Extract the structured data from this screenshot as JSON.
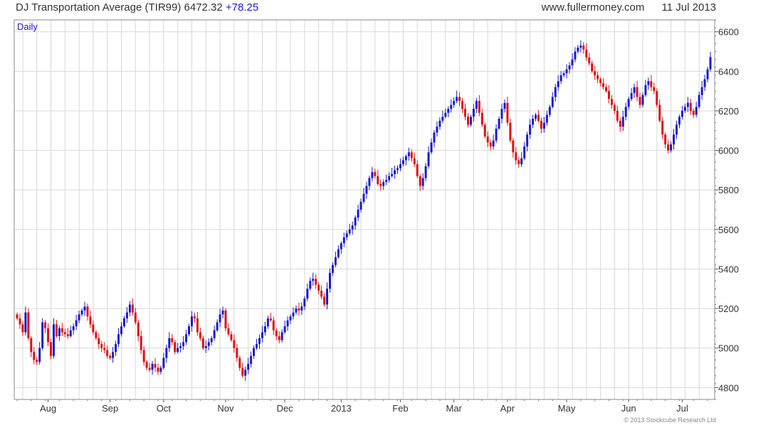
{
  "header": {
    "title": "DJ Transportation Average (TIR99)",
    "last": "6472.32",
    "change": "+78.25",
    "site": "www.fullermoney.com",
    "date": "11 Jul 2013"
  },
  "footer": {
    "copyright": "© 2013 Stockcube Research Ltd"
  },
  "colors": {
    "up": "#1a1acc",
    "down": "#dd1111",
    "grid": "#d8d8d8",
    "frame": "#888888"
  },
  "chart_data": {
    "type": "ohlc-bar",
    "period_label": "Daily",
    "ylim": [
      4740,
      6660
    ],
    "y_ticks": [
      4800,
      5000,
      5200,
      5400,
      5600,
      5800,
      6000,
      6200,
      6400,
      6600
    ],
    "y_axis_side": "right",
    "grid": true,
    "x_labels": [
      {
        "label": "Aug",
        "index": 11
      },
      {
        "label": "Sep",
        "index": 33
      },
      {
        "label": "Oct",
        "index": 52
      },
      {
        "label": "Nov",
        "index": 74
      },
      {
        "label": "Dec",
        "index": 95
      },
      {
        "label": "2013",
        "index": 115
      },
      {
        "label": "Feb",
        "index": 136
      },
      {
        "label": "Mar",
        "index": 155
      },
      {
        "label": "Apr",
        "index": 174
      },
      {
        "label": "May",
        "index": 195
      },
      {
        "label": "Jun",
        "index": 217
      },
      {
        "label": "Jul",
        "index": 236
      }
    ],
    "closes": [
      5150,
      5120,
      5080,
      5180,
      5050,
      4980,
      4940,
      4930,
      5000,
      5130,
      5100,
      5030,
      4960,
      5120,
      5060,
      5100,
      5080,
      5070,
      5060,
      5090,
      5110,
      5140,
      5170,
      5190,
      5210,
      5160,
      5120,
      5080,
      5050,
      5020,
      5000,
      4990,
      4960,
      4950,
      4980,
      5020,
      5070,
      5110,
      5150,
      5180,
      5220,
      5180,
      5130,
      5060,
      4990,
      4930,
      4900,
      4890,
      4920,
      4900,
      4880,
      4900,
      4950,
      5000,
      5050,
      5030,
      4980,
      5000,
      5010,
      5030,
      5070,
      5110,
      5160,
      5150,
      5080,
      5050,
      5000,
      5010,
      5030,
      5050,
      5090,
      5130,
      5170,
      5190,
      5100,
      5070,
      5040,
      5000,
      4950,
      4900,
      4860,
      4890,
      4920,
      4960,
      5000,
      5020,
      5050,
      5080,
      5110,
      5150,
      5140,
      5090,
      5060,
      5040,
      5080,
      5110,
      5140,
      5160,
      5180,
      5200,
      5190,
      5210,
      5250,
      5300,
      5340,
      5350,
      5320,
      5290,
      5260,
      5220,
      5300,
      5380,
      5420,
      5460,
      5500,
      5530,
      5560,
      5580,
      5600,
      5620,
      5660,
      5700,
      5740,
      5780,
      5820,
      5860,
      5890,
      5870,
      5830,
      5820,
      5840,
      5850,
      5870,
      5880,
      5900,
      5910,
      5930,
      5950,
      5970,
      5990,
      5960,
      5930,
      5870,
      5820,
      5860,
      5920,
      5990,
      6040,
      6090,
      6120,
      6150,
      6170,
      6190,
      6210,
      6230,
      6250,
      6270,
      6250,
      6210,
      6170,
      6130,
      6170,
      6210,
      6250,
      6190,
      6130,
      6070,
      6040,
      6020,
      6050,
      6110,
      6160,
      6210,
      6240,
      6140,
      6050,
      5990,
      5950,
      5930,
      5960,
      6020,
      6080,
      6130,
      6160,
      6180,
      6150,
      6110,
      6140,
      6180,
      6220,
      6270,
      6320,
      6350,
      6380,
      6390,
      6410,
      6430,
      6460,
      6500,
      6520,
      6530,
      6510,
      6470,
      6440,
      6400,
      6380,
      6360,
      6340,
      6320,
      6300,
      6260,
      6230,
      6200,
      6150,
      6120,
      6170,
      6220,
      6260,
      6290,
      6320,
      6270,
      6230,
      6280,
      6330,
      6350,
      6320,
      6300,
      6230,
      6150,
      6080,
      6030,
      6000,
      6030,
      6080,
      6130,
      6170,
      6200,
      6220,
      6240,
      6200,
      6180,
      6220,
      6280,
      6320,
      6360,
      6410,
      6472
    ]
  }
}
